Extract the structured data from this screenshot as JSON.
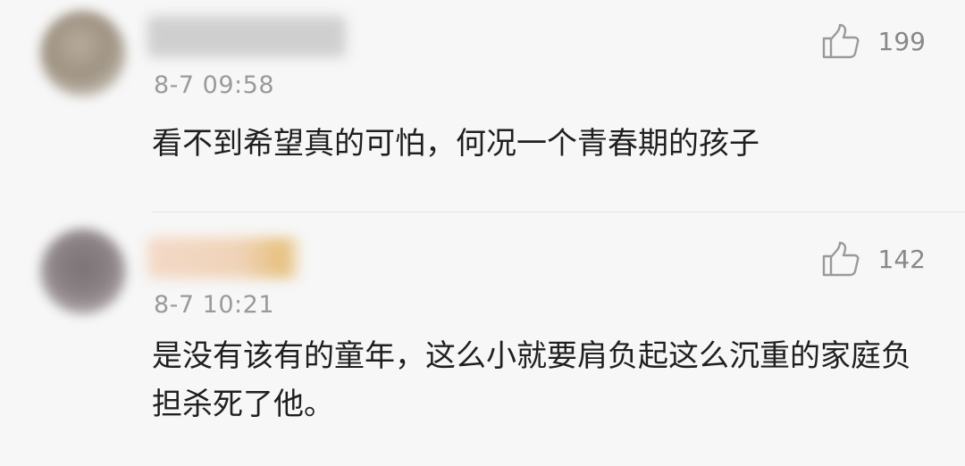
{
  "comments": [
    {
      "timestamp": "8-7 09:58",
      "text": "看不到希望真的可怕，何况一个青春期的孩子",
      "likes": "199"
    },
    {
      "timestamp": "8-7 10:21",
      "text": "是没有该有的童年，这么小就要肩负起这么沉重的家庭负担杀死了他。",
      "likes": "142"
    }
  ],
  "icons": {
    "like": "thumbs-up-icon"
  }
}
